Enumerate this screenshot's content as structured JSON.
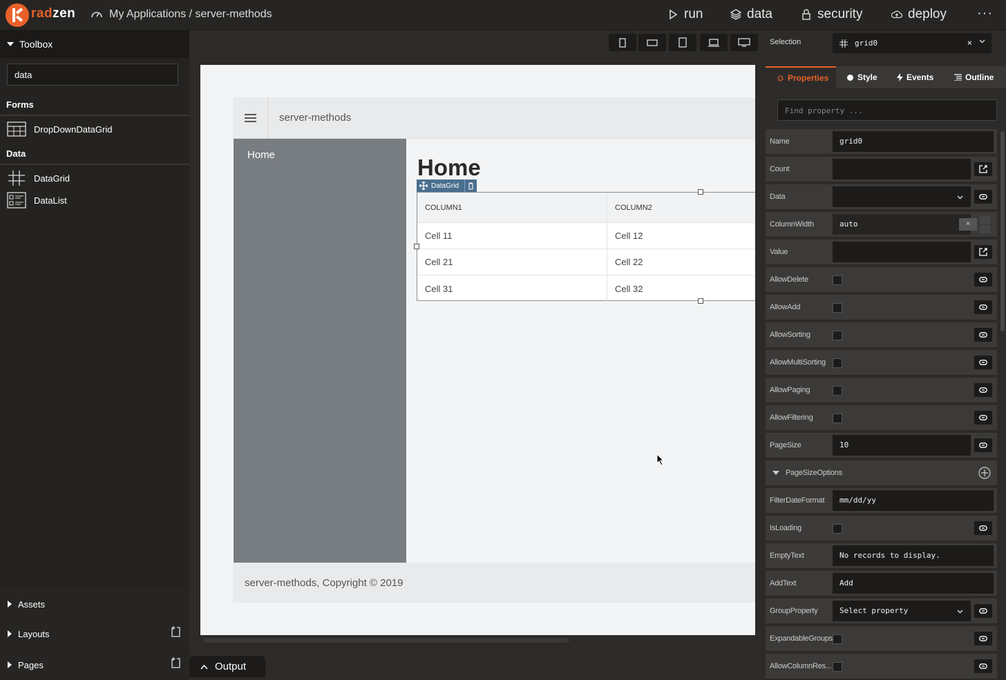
{
  "brand": {
    "part1": "rad",
    "part2": "zen"
  },
  "breadcrumb": "My Applications / server-methods",
  "topnav": [
    {
      "label": "run",
      "icon": "play-icon"
    },
    {
      "label": "data",
      "icon": "layers-icon"
    },
    {
      "label": "security",
      "icon": "lock-icon"
    },
    {
      "label": "deploy",
      "icon": "cloud-upload-icon"
    }
  ],
  "more": "···",
  "toolbox": {
    "title": "Toolbox",
    "search_value": "data",
    "sections": [
      {
        "title": "Forms",
        "items": [
          {
            "label": "DropDownDataGrid",
            "icon": "dropdown-datagrid-icon"
          }
        ]
      },
      {
        "title": "Data",
        "items": [
          {
            "label": "DataGrid",
            "icon": "datagrid-icon"
          },
          {
            "label": "DataList",
            "icon": "datalist-icon"
          }
        ]
      }
    ],
    "bottom": [
      {
        "label": "Assets"
      },
      {
        "label": "Layouts"
      },
      {
        "label": "Pages"
      }
    ]
  },
  "canvas": {
    "header_title": "server-methods",
    "nav_home": "Home",
    "heading": "Home",
    "component_tag": "DataGrid",
    "grid": {
      "columns": [
        "COLUMN1",
        "COLUMN2"
      ],
      "rows": [
        [
          "Cell 11",
          "Cell 12"
        ],
        [
          "Cell 21",
          "Cell 22"
        ],
        [
          "Cell 31",
          "Cell 32"
        ]
      ]
    },
    "footer": "server-methods, Copyright © 2019"
  },
  "output_label": "Output",
  "selection": {
    "label": "Selection",
    "value": "grid0",
    "clear": "×"
  },
  "tabs": [
    {
      "label": "Properties",
      "active": true
    },
    {
      "label": "Style"
    },
    {
      "label": "Events"
    },
    {
      "label": "Outline"
    }
  ],
  "find_placeholder": "Find property ...",
  "properties": [
    {
      "name": "Name",
      "type": "text",
      "value": "grid0"
    },
    {
      "name": "Count",
      "type": "text-btn",
      "value": "",
      "btn": "edit-icon"
    },
    {
      "name": "Data",
      "type": "select-btn",
      "value": "",
      "btn": "link-icon"
    },
    {
      "name": "ColumnWidth",
      "type": "spinner",
      "value": "auto"
    },
    {
      "name": "Value",
      "type": "text-btn",
      "value": "",
      "btn": "edit-icon"
    },
    {
      "name": "AllowDelete",
      "type": "check"
    },
    {
      "name": "AllowAdd",
      "type": "check"
    },
    {
      "name": "AllowSorting",
      "type": "check"
    },
    {
      "name": "AllowMultiSorting",
      "type": "check"
    },
    {
      "name": "AllowPaging",
      "type": "check"
    },
    {
      "name": "AllowFiltering",
      "type": "check"
    },
    {
      "name": "PageSize",
      "type": "text-btn",
      "value": "10",
      "btn": "link-icon"
    },
    {
      "name": "PageSizeOptions",
      "type": "group"
    },
    {
      "name": "FilterDateFormat",
      "type": "text",
      "value": "mm/dd/yy"
    },
    {
      "name": "IsLoading",
      "type": "check"
    },
    {
      "name": "EmptyText",
      "type": "text",
      "value": "No records to display."
    },
    {
      "name": "AddText",
      "type": "text",
      "value": "Add"
    },
    {
      "name": "GroupProperty",
      "type": "select-btn",
      "value": "Select property",
      "btn": "link-icon"
    },
    {
      "name": "ExpandableGroups",
      "type": "check"
    },
    {
      "name": "AllowColumnRes...",
      "type": "check"
    }
  ]
}
